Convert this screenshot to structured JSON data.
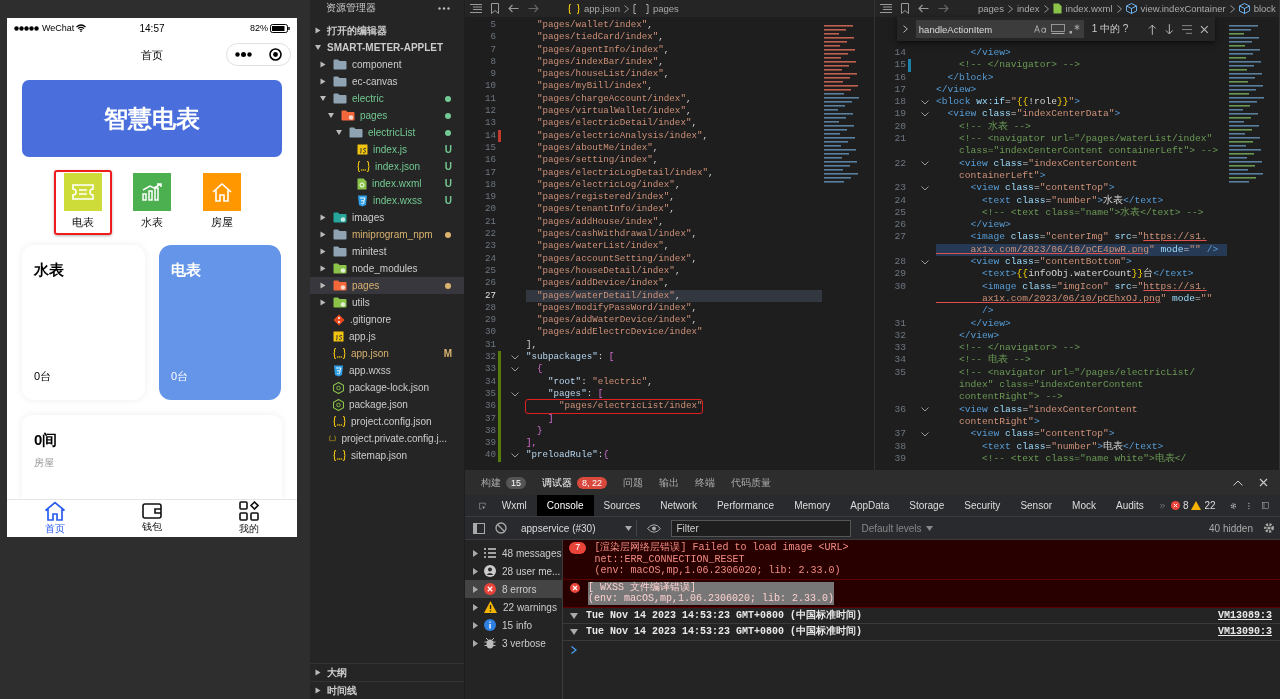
{
  "simulator": {
    "status_bar": {
      "carrier": "WeChat",
      "time": "14:57",
      "battery": "82%"
    },
    "nav_title": "首页",
    "banner": "智慧电表",
    "shortcuts": [
      {
        "label": "电表",
        "kind": "ticket",
        "color": "#cddc39",
        "highlighted": true
      },
      {
        "label": "水表",
        "kind": "chart",
        "color": "#4caf50",
        "highlighted": false
      },
      {
        "label": "房屋",
        "kind": "house",
        "color": "#ff9800",
        "highlighted": false
      }
    ],
    "cards": [
      {
        "title": "水表",
        "count": "0台",
        "kind": "plain"
      },
      {
        "title": "电表",
        "count": "0台",
        "kind": "accent"
      }
    ],
    "summary": {
      "value": "0间",
      "label": "房屋"
    },
    "tabbar": [
      {
        "label": "首页",
        "kind": "home",
        "selected": true
      },
      {
        "label": "钱包",
        "kind": "wallet",
        "selected": false
      },
      {
        "label": "我的",
        "kind": "apps",
        "selected": false
      }
    ]
  },
  "explorer": {
    "title": "资源管理器",
    "sections": [
      {
        "title": "打开的编辑器",
        "expanded": false
      },
      {
        "title": "SMART-METER-APPLET",
        "expanded": true,
        "children": [
          {
            "name": "component",
            "kind": "folder",
            "expanded": false
          },
          {
            "name": "ec-canvas",
            "kind": "folder",
            "expanded": false
          },
          {
            "name": "electric",
            "kind": "folder",
            "expanded": true,
            "color": "#73c991",
            "dot": true,
            "children": [
              {
                "name": "pages",
                "kind": "pages",
                "expanded": true,
                "color": "#73c991",
                "dot": true,
                "children": [
                  {
                    "name": "electricList",
                    "kind": "folder",
                    "expanded": true,
                    "color": "#73c991",
                    "dot": true,
                    "children": [
                      {
                        "name": "index.js",
                        "kind": "js",
                        "color": "#73c991",
                        "badge": "U"
                      },
                      {
                        "name": "index.json",
                        "kind": "json",
                        "color": "#73c991",
                        "badge": "U"
                      },
                      {
                        "name": "index.wxml",
                        "kind": "wxml",
                        "color": "#73c991",
                        "badge": "U"
                      },
                      {
                        "name": "index.wxss",
                        "kind": "wxss",
                        "color": "#73c991",
                        "badge": "U"
                      }
                    ]
                  }
                ]
              }
            ]
          },
          {
            "name": "images",
            "kind": "images",
            "expanded": false
          },
          {
            "name": "miniprogram_npm",
            "kind": "folder",
            "expanded": false,
            "color": "#d9b26f",
            "dot": true
          },
          {
            "name": "minitest",
            "kind": "folder",
            "expanded": false
          },
          {
            "name": "node_modules",
            "kind": "node",
            "expanded": false
          },
          {
            "name": "pages",
            "kind": "pages",
            "expanded": false,
            "color": "#d9b26f",
            "dot": true,
            "selected": true
          },
          {
            "name": "utils",
            "kind": "node",
            "expanded": false
          },
          {
            "name": ".gitignore",
            "kind": "git"
          },
          {
            "name": "app.js",
            "kind": "js"
          },
          {
            "name": "app.json",
            "kind": "json",
            "color": "#d9b26f",
            "badge": "M"
          },
          {
            "name": "app.wxss",
            "kind": "wxss"
          },
          {
            "name": "package-lock.json",
            "kind": "npm"
          },
          {
            "name": "package.json",
            "kind": "npm"
          },
          {
            "name": "project.config.json",
            "kind": "json"
          },
          {
            "name": "project.private.config.j...",
            "kind": "json"
          },
          {
            "name": "sitemap.json",
            "kind": "json"
          }
        ]
      }
    ],
    "bottom_sections": [
      {
        "title": "大纲",
        "expanded": false
      },
      {
        "title": "时间线",
        "expanded": false
      }
    ]
  },
  "editors": [
    {
      "breadcrumb": [
        {
          "label": "app.json",
          "kind": "json"
        },
        {
          "label": "pages",
          "kind": "array"
        }
      ],
      "rows": [
        {
          "num": "5",
          "segs": [
            {
              "text": "  \"pages/wallet/index\"",
              "kind": "str"
            },
            {
              "text": ",",
              "kind": "p"
            }
          ]
        },
        {
          "num": "6",
          "segs": [
            {
              "text": "  \"pages/tiedCard/index\"",
              "kind": "str"
            },
            {
              "text": ",",
              "kind": "p"
            }
          ]
        },
        {
          "num": "7",
          "segs": [
            {
              "text": "  \"pages/agentInfo/index\"",
              "kind": "str"
            },
            {
              "text": ",",
              "kind": "p"
            }
          ]
        },
        {
          "num": "8",
          "segs": [
            {
              "text": "  \"pages/indexBar/index\"",
              "kind": "str"
            },
            {
              "text": ",",
              "kind": "p"
            }
          ]
        },
        {
          "num": "9",
          "segs": [
            {
              "text": "  \"pages/houseList/index\"",
              "kind": "str"
            },
            {
              "text": ",",
              "kind": "p"
            }
          ]
        },
        {
          "num": "10",
          "segs": [
            {
              "text": "  \"pages/myBill/index\"",
              "kind": "str"
            },
            {
              "text": ",",
              "kind": "p"
            }
          ]
        },
        {
          "num": "11",
          "segs": [
            {
              "text": "  \"pages/chargeAccount/index\"",
              "kind": "str"
            },
            {
              "text": ",",
              "kind": "p"
            }
          ]
        },
        {
          "num": "12",
          "segs": [
            {
              "text": "  \"pages/virtualWallet/index\"",
              "kind": "str"
            },
            {
              "text": ",",
              "kind": "p"
            }
          ]
        },
        {
          "num": "13",
          "segs": [
            {
              "text": "  \"pages/electricDetail/index\"",
              "kind": "str"
            },
            {
              "text": ",",
              "kind": "p"
            }
          ]
        },
        {
          "num": "14",
          "color": "#c0392b",
          "segs": [
            {
              "text": "  \"pages/electricAnalysis/index\"",
              "kind": "str"
            },
            {
              "text": ",",
              "kind": "p"
            }
          ]
        },
        {
          "num": "15",
          "segs": [
            {
              "text": "  \"pages/aboutMe/index\"",
              "kind": "str"
            },
            {
              "text": ",",
              "kind": "p"
            }
          ]
        },
        {
          "num": "16",
          "segs": [
            {
              "text": "  \"pages/setting/index\"",
              "kind": "str"
            },
            {
              "text": ",",
              "kind": "p"
            }
          ]
        },
        {
          "num": "17",
          "segs": [
            {
              "text": "  \"pages/electricLogDetail/index\"",
              "kind": "str"
            },
            {
              "text": ",",
              "kind": "p"
            }
          ]
        },
        {
          "num": "18",
          "segs": [
            {
              "text": "  \"pages/electricLog/index\"",
              "kind": "str"
            },
            {
              "text": ",",
              "kind": "p"
            }
          ]
        },
        {
          "num": "19",
          "segs": [
            {
              "text": "  \"pages/registered/index\"",
              "kind": "str"
            },
            {
              "text": ",",
              "kind": "p"
            }
          ]
        },
        {
          "num": "20",
          "segs": [
            {
              "text": "  \"pages/tenantInfo/index\"",
              "kind": "str"
            },
            {
              "text": ",",
              "kind": "p"
            }
          ]
        },
        {
          "num": "21",
          "segs": [
            {
              "text": "  \"pages/addHouse/index\"",
              "kind": "str"
            },
            {
              "text": ",",
              "kind": "p"
            }
          ]
        },
        {
          "num": "22",
          "segs": [
            {
              "text": "  \"pages/cashWithdrawal/index\"",
              "kind": "str"
            },
            {
              "text": ",",
              "kind": "p"
            }
          ]
        },
        {
          "num": "23",
          "segs": [
            {
              "text": "  \"pages/waterList/index\"",
              "kind": "str"
            },
            {
              "text": ",",
              "kind": "p"
            }
          ]
        },
        {
          "num": "24",
          "segs": [
            {
              "text": "  \"pages/accountSetting/index\"",
              "kind": "str"
            },
            {
              "text": ",",
              "kind": "p"
            }
          ]
        },
        {
          "num": "25",
          "segs": [
            {
              "text": "  \"pages/houseDetail/index\"",
              "kind": "str"
            },
            {
              "text": ",",
              "kind": "p"
            }
          ]
        },
        {
          "num": "26",
          "segs": [
            {
              "text": "  \"pages/addDevice/index\"",
              "kind": "str"
            },
            {
              "text": ",",
              "kind": "p"
            }
          ]
        },
        {
          "num": "27",
          "current": true,
          "segs": [
            {
              "text": "  \"pages/waterDetail/index\"",
              "kind": "str"
            },
            {
              "text": ",",
              "kind": "p"
            }
          ]
        },
        {
          "num": "28",
          "segs": [
            {
              "text": "  \"pages/modifyPassWord/index\"",
              "kind": "str"
            },
            {
              "text": ",",
              "kind": "p"
            }
          ]
        },
        {
          "num": "29",
          "segs": [
            {
              "text": "  \"pages/addWaterDevice/index\"",
              "kind": "str"
            },
            {
              "text": ",",
              "kind": "p"
            }
          ]
        },
        {
          "num": "30",
          "segs": [
            {
              "text": "  \"pages/addElectrcDevice/index\"",
              "kind": "str"
            }
          ]
        },
        {
          "num": "31",
          "segs": [
            {
              "text": "],",
              "kind": "p"
            }
          ]
        },
        {
          "num": "32",
          "fold": true,
          "color": "#587c0c",
          "segs": [
            {
              "text": "\"subpackages\"",
              "kind": "key"
            },
            {
              "text": ": ",
              "kind": "p"
            },
            {
              "text": "[",
              "kind": "br"
            }
          ]
        },
        {
          "num": "33",
          "fold": true,
          "color": "#587c0c",
          "segs": [
            {
              "text": "  {",
              "kind": "br"
            }
          ]
        },
        {
          "num": "34",
          "color": "#587c0c",
          "segs": [
            {
              "text": "    \"root\"",
              "kind": "key"
            },
            {
              "text": ": ",
              "kind": "p"
            },
            {
              "text": "\"electric\"",
              "kind": "str"
            },
            {
              "text": ",",
              "kind": "p"
            }
          ]
        },
        {
          "num": "35",
          "fold": true,
          "color": "#587c0c",
          "segs": [
            {
              "text": "    \"pages\"",
              "kind": "key"
            },
            {
              "text": ": ",
              "kind": "p"
            },
            {
              "text": "[",
              "kind": "br"
            }
          ]
        },
        {
          "num": "36",
          "color": "#587c0c",
          "highlighted": true,
          "segs": [
            {
              "text": "      \"pages/electricList/index\"",
              "kind": "str"
            }
          ]
        },
        {
          "num": "37",
          "color": "#587c0c",
          "segs": [
            {
              "text": "    ]",
              "kind": "br"
            }
          ]
        },
        {
          "num": "38",
          "color": "#587c0c",
          "segs": [
            {
              "text": "  }",
              "kind": "br"
            }
          ]
        },
        {
          "num": "39",
          "color": "#587c0c",
          "segs": [
            {
              "text": "],",
              "kind": "br"
            }
          ]
        },
        {
          "num": "40",
          "fold": true,
          "color": "#587c0c",
          "segs": [
            {
              "text": "\"preloadRule\"",
              "kind": "key"
            },
            {
              "text": ":",
              "kind": "p"
            },
            {
              "text": "{",
              "kind": "br"
            }
          ]
        }
      ]
    },
    {
      "breadcrumb": [
        {
          "label": "pages"
        },
        {
          "label": "index"
        },
        {
          "label": "index.wxml",
          "kind": "wxml"
        },
        {
          "label": "view.indexContainer",
          "kind": "cube"
        },
        {
          "label": "block",
          "kind": "cube"
        }
      ],
      "find": {
        "value": "handleActionItem",
        "result": "1 中的 ?"
      },
      "rows": [
        {
          "num": "14",
          "segs": [
            {
              "text": "      </view>",
              "kind": "tag"
            }
          ]
        },
        {
          "num": "15",
          "color": "#1b81a8",
          "segs": [
            {
              "text": "    <!-- </navigator> -->",
              "kind": "cm"
            }
          ]
        },
        {
          "num": "16",
          "segs": [
            {
              "text": "  </block>",
              "kind": "tag"
            }
          ]
        },
        {
          "num": "17",
          "segs": [
            {
              "text": "</view>",
              "kind": "tag"
            }
          ]
        },
        {
          "num": "18",
          "fold": true,
          "segs": [
            {
              "text": "<block ",
              "kind": "tag"
            },
            {
              "text": "wx:if",
              "kind": "attr"
            },
            {
              "text": "=",
              "kind": "p"
            },
            {
              "text": "\"",
              "kind": "str"
            },
            {
              "text": "{{",
              "kind": "brace"
            },
            {
              "text": "!role",
              "kind": "p"
            },
            {
              "text": "}}",
              "kind": "brace"
            },
            {
              "text": "\"",
              "kind": "str"
            },
            {
              "text": ">",
              "kind": "tag"
            }
          ]
        },
        {
          "num": "19",
          "fold": true,
          "segs": [
            {
              "text": "  <view ",
              "kind": "tag"
            },
            {
              "text": "class",
              "kind": "attr"
            },
            {
              "text": "=",
              "kind": "p"
            },
            {
              "text": "\"indexCenterData\"",
              "kind": "str"
            },
            {
              "text": ">",
              "kind": "tag"
            }
          ]
        },
        {
          "num": "20",
          "segs": [
            {
              "text": "    <!-- 水表 -->",
              "kind": "cm"
            }
          ]
        },
        {
          "num": "21",
          "segs": [
            {
              "text": "    <!-- <navigator url=\"/pages/waterList/index\"",
              "kind": "cm"
            }
          ]
        },
        {
          "segs": [
            {
              "text": "    class=\"indexCenterContent containerLeft\"> -->",
              "kind": "cm"
            }
          ]
        },
        {
          "num": "22",
          "fold": true,
          "segs": [
            {
              "text": "    <view ",
              "kind": "tag"
            },
            {
              "text": "class",
              "kind": "attr"
            },
            {
              "text": "=",
              "kind": "p"
            },
            {
              "text": "\"indexCenterContent",
              "kind": "str"
            }
          ]
        },
        {
          "segs": [
            {
              "text": "    containerLeft\"",
              "kind": "str"
            },
            {
              "text": ">",
              "kind": "tag"
            }
          ]
        },
        {
          "num": "23",
          "fold": true,
          "segs": [
            {
              "text": "      <view ",
              "kind": "tag"
            },
            {
              "text": "class",
              "kind": "attr"
            },
            {
              "text": "=",
              "kind": "p"
            },
            {
              "text": "\"contentTop\"",
              "kind": "str"
            },
            {
              "text": ">",
              "kind": "tag"
            }
          ]
        },
        {
          "num": "24",
          "segs": [
            {
              "text": "        <text ",
              "kind": "tag"
            },
            {
              "text": "class",
              "kind": "attr"
            },
            {
              "text": "=",
              "kind": "p"
            },
            {
              "text": "\"number\"",
              "kind": "str"
            },
            {
              "text": ">",
              "kind": "tag"
            },
            {
              "text": "水表",
              "kind": "p"
            },
            {
              "text": "</text>",
              "kind": "tag"
            }
          ]
        },
        {
          "num": "25",
          "segs": [
            {
              "text": "        <!-- <text class=\"name\">水表</text> -->",
              "kind": "cm"
            }
          ]
        },
        {
          "num": "26",
          "segs": [
            {
              "text": "      </view>",
              "kind": "tag"
            }
          ]
        },
        {
          "num": "27",
          "segs": [
            {
              "text": "      <image ",
              "kind": "tag"
            },
            {
              "text": "class",
              "kind": "attr"
            },
            {
              "text": "=",
              "kind": "p"
            },
            {
              "text": "\"centerImg\"",
              "kind": "str"
            },
            {
              "text": " src",
              "kind": "attr"
            },
            {
              "text": "=",
              "kind": "p"
            },
            {
              "text": "\"",
              "kind": "str"
            },
            {
              "text": "https://s1.",
              "kind": "url"
            }
          ]
        },
        {
          "current": true,
          "segs": [
            {
              "text": "      ax1x.com/2023/06/10/pCE4pwR.png",
              "kind": "url"
            },
            {
              "text": "\"",
              "kind": "str"
            },
            {
              "text": " mode",
              "kind": "attr"
            },
            {
              "text": "=",
              "kind": "p"
            },
            {
              "text": "\"\"",
              "kind": "str"
            },
            {
              "text": " />",
              "kind": "tag"
            }
          ]
        },
        {
          "num": "28",
          "fold": true,
          "segs": [
            {
              "text": "      <view ",
              "kind": "tag"
            },
            {
              "text": "class",
              "kind": "attr"
            },
            {
              "text": "=",
              "kind": "p"
            },
            {
              "text": "\"contentBottom\"",
              "kind": "str"
            },
            {
              "text": ">",
              "kind": "tag"
            }
          ]
        },
        {
          "num": "29",
          "segs": [
            {
              "text": "        <text>",
              "kind": "tag"
            },
            {
              "text": "{{",
              "kind": "brace"
            },
            {
              "text": "infoObj.waterCount",
              "kind": "p"
            },
            {
              "text": "}}",
              "kind": "brace"
            },
            {
              "text": "台",
              "kind": "p"
            },
            {
              "text": "</text>",
              "kind": "tag"
            }
          ]
        },
        {
          "num": "30",
          "segs": [
            {
              "text": "        <image ",
              "kind": "tag"
            },
            {
              "text": "class",
              "kind": "attr"
            },
            {
              "text": "=",
              "kind": "p"
            },
            {
              "text": "\"imgIcon\"",
              "kind": "str"
            },
            {
              "text": " src",
              "kind": "attr"
            },
            {
              "text": "=",
              "kind": "p"
            },
            {
              "text": "\"",
              "kind": "str"
            },
            {
              "text": "https://s1.",
              "kind": "url"
            }
          ]
        },
        {
          "segs": [
            {
              "text": "        ax1x.com/2023/06/10/pCEhxOJ.png",
              "kind": "url"
            },
            {
              "text": "\"",
              "kind": "str"
            },
            {
              "text": " mode",
              "kind": "attr"
            },
            {
              "text": "=",
              "kind": "p"
            },
            {
              "text": "\"\"",
              "kind": "str"
            }
          ]
        },
        {
          "segs": [
            {
              "text": "        />",
              "kind": "tag"
            }
          ]
        },
        {
          "num": "31",
          "segs": [
            {
              "text": "      </view>",
              "kind": "tag"
            }
          ]
        },
        {
          "num": "32",
          "segs": [
            {
              "text": "    </view>",
              "kind": "tag"
            }
          ]
        },
        {
          "num": "33",
          "segs": [
            {
              "text": "    <!-- </navigator> -->",
              "kind": "cm"
            }
          ]
        },
        {
          "num": "34",
          "segs": [
            {
              "text": "    <!-- 电表 -->",
              "kind": "cm"
            }
          ]
        },
        {
          "num": "35",
          "segs": [
            {
              "text": "    <!-- <navigator url=\"/pages/electricList/",
              "kind": "cm"
            }
          ]
        },
        {
          "segs": [
            {
              "text": "    index\" class=\"indexCenterContent",
              "kind": "cm"
            }
          ]
        },
        {
          "segs": [
            {
              "text": "    contentRight\"> -->",
              "kind": "cm"
            }
          ]
        },
        {
          "num": "36",
          "fold": true,
          "segs": [
            {
              "text": "    <view ",
              "kind": "tag"
            },
            {
              "text": "class",
              "kind": "attr"
            },
            {
              "text": "=",
              "kind": "p"
            },
            {
              "text": "\"indexCenterContent",
              "kind": "str"
            }
          ]
        },
        {
          "segs": [
            {
              "text": "    contentRight\"",
              "kind": "str"
            },
            {
              "text": ">",
              "kind": "tag"
            }
          ]
        },
        {
          "num": "37",
          "fold": true,
          "segs": [
            {
              "text": "      <view ",
              "kind": "tag"
            },
            {
              "text": "class",
              "kind": "attr"
            },
            {
              "text": "=",
              "kind": "p"
            },
            {
              "text": "\"contentTop\"",
              "kind": "str"
            },
            {
              "text": ">",
              "kind": "tag"
            }
          ]
        },
        {
          "num": "38",
          "segs": [
            {
              "text": "        <text ",
              "kind": "tag"
            },
            {
              "text": "class",
              "kind": "attr"
            },
            {
              "text": "=",
              "kind": "p"
            },
            {
              "text": "\"number\"",
              "kind": "str"
            },
            {
              "text": ">",
              "kind": "tag"
            },
            {
              "text": "电表",
              "kind": "p"
            },
            {
              "text": "</text>",
              "kind": "tag"
            }
          ]
        },
        {
          "num": "39",
          "segs": [
            {
              "text": "        <!-- <text class=\"name white\">电表</",
              "kind": "cm"
            }
          ]
        }
      ]
    }
  ],
  "devtools": {
    "panel_tabs": [
      {
        "label": "构建",
        "badge": {
          "text": "15",
          "color": "#555555"
        },
        "selected": false
      },
      {
        "label": "调试器",
        "badge": {
          "text": "8, 22",
          "color": "#d8483c"
        },
        "selected": true
      },
      {
        "label": "问题",
        "selected": false
      },
      {
        "label": "输出",
        "selected": false
      },
      {
        "label": "终端",
        "selected": false
      },
      {
        "label": "代码质量",
        "selected": false
      }
    ],
    "tool_tabs": [
      {
        "label": "Wxml",
        "selected": false
      },
      {
        "label": "Console",
        "selected": true
      },
      {
        "label": "Sources",
        "selected": false
      },
      {
        "label": "Network",
        "selected": false
      },
      {
        "label": "Performance",
        "selected": false
      },
      {
        "label": "Memory",
        "selected": false
      },
      {
        "label": "AppData",
        "selected": false
      },
      {
        "label": "Storage",
        "selected": false
      },
      {
        "label": "Security",
        "selected": false
      },
      {
        "label": "Sensor",
        "selected": false
      },
      {
        "label": "Mock",
        "selected": false
      },
      {
        "label": "Audits",
        "selected": false
      }
    ],
    "error_count": "8",
    "warning_count": "22",
    "context": "appservice (#30)",
    "filter_placeholder": "Filter",
    "levels": "Default levels",
    "hidden": "40 hidden",
    "sidebar": [
      {
        "label": "48 messages",
        "kind": "list",
        "selected": false
      },
      {
        "label": "28 user me...",
        "kind": "user",
        "selected": false
      },
      {
        "label": "8 errors",
        "kind": "error",
        "selected": true
      },
      {
        "label": "22 warnings",
        "kind": "warning",
        "selected": false
      },
      {
        "label": "15 info",
        "kind": "info",
        "selected": false
      },
      {
        "label": "3 verbose",
        "kind": "bug",
        "selected": false
      }
    ],
    "messages": [
      {
        "kind": "error",
        "count": "7",
        "lines": [
          "[渲染层网络层错误] Failed to load image <URL>",
          "net::ERR_CONNECTION_RESET",
          "(env: macOS,mp,1.06.2306020; lib: 2.33.0)"
        ]
      },
      {
        "kind": "error",
        "selected": true,
        "lines": [
          "[ WXSS 文件编译错误]",
          "(env: macOS,mp,1.06.2306020; lib: 2.33.0)"
        ]
      },
      {
        "kind": "log",
        "lines": [
          "Tue Nov 14 2023 14:53:23 GMT+0800 (中国标准时间)"
        ],
        "source": "VM13089:3"
      },
      {
        "kind": "log",
        "lines": [
          "Tue Nov 14 2023 14:53:23 GMT+0800 (中国标准时间)"
        ],
        "source": "VM13090:3"
      }
    ]
  }
}
